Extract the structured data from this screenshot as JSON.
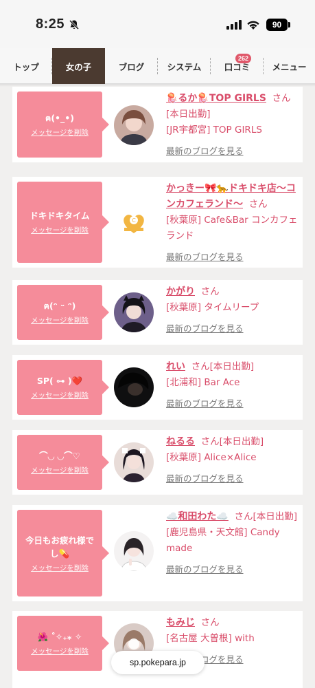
{
  "status": {
    "time": "8:25",
    "battery": "90"
  },
  "nav": {
    "tabs": [
      {
        "label": "トップ"
      },
      {
        "label": "女の子"
      },
      {
        "label": "ブログ"
      },
      {
        "label": "システム"
      },
      {
        "label": "口コミ",
        "badge": "262"
      },
      {
        "label": "メニュー"
      }
    ]
  },
  "cards": [
    {
      "message": "ฅ(•_•)",
      "delete": "メッセージを削除",
      "name": "🪼るか🪼TOP GIRLS",
      "san": "さん",
      "lines": [
        "[本日出勤]",
        "[JR宇都宮] TOP GIRLS"
      ],
      "blog": "最新のブログを見る"
    },
    {
      "message": "ドキドキタイム",
      "delete": "メッセージを削除",
      "name": "かっきー🎀🐆ドキドキ店〜コンカフェランド〜",
      "san": "さん",
      "lines": [
        "[秋葉原] Cafe&Bar コンカフェランド"
      ],
      "blog": "最新のブログを見る"
    },
    {
      "message": "ฅ(ᵔ ᵕ ᵔ)",
      "delete": "メッセージを削除",
      "name": "かがり",
      "san": "さん",
      "lines": [
        "[秋葉原] タイムリープ"
      ],
      "blog": "最新のブログを見る"
    },
    {
      "message": "SP( ⊶ )❤️",
      "delete": "メッセージを削除",
      "name": "れい",
      "san": "さん[本日出勤]",
      "lines": [
        "[北浦和] Bar Ace"
      ],
      "blog": "最新のブログを見る"
    },
    {
      "message": "⌒◡ ◡⌒♡",
      "delete": "メッセージを削除",
      "name": "ねるる",
      "san": "さん[本日出勤]",
      "lines": [
        "[秋葉原] Alice×Alice"
      ],
      "blog": "最新のブログを見る"
    },
    {
      "message": "今日もお疲れ様でし💊",
      "delete": "メッセージを削除",
      "name": "☁️和田わた☁️",
      "san": "さん[本日出勤]",
      "lines": [
        "[鹿児島県・天文館] Candy made"
      ],
      "blog": "最新のブログを見る"
    },
    {
      "message": "🌺 ˚✧₊⁎ ✧",
      "delete": "メッセージを削除",
      "name": "もみじ",
      "san": "さん",
      "lines": [
        "[名古屋 大曽根] with"
      ],
      "blog": "最新のブログを見る"
    }
  ],
  "url": "sp.pokepara.jp",
  "colors": {
    "accent": "#d94d6a",
    "message_bg": "#f58c9a",
    "active_tab": "#4b3a30"
  }
}
